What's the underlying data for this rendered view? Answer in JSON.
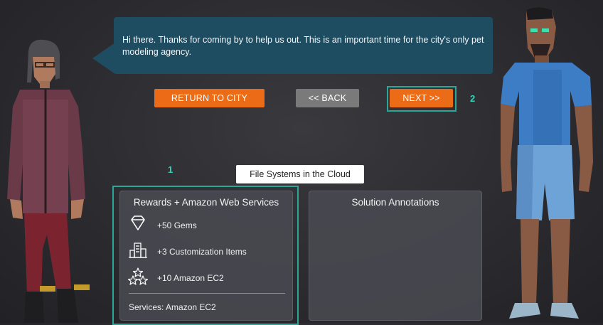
{
  "dialog": {
    "message": "Hi there. Thanks for coming by to help us out. This is an important time for the city's only pet modeling agency."
  },
  "buttons": {
    "return_label": "RETURN TO CITY",
    "back_label": "<< BACK",
    "next_label": "NEXT >>"
  },
  "markers": {
    "one": "1",
    "two": "2"
  },
  "tooltip": "File Systems in the Cloud",
  "rewards_panel": {
    "title": "Rewards + Amazon Web Services",
    "items": [
      {
        "icon": "gem-icon",
        "label": "+50 Gems"
      },
      {
        "icon": "building-icon",
        "label": "+3 Customization Items"
      },
      {
        "icon": "stars-icon",
        "label": "+10 Amazon EC2"
      }
    ],
    "services": "Services: Amazon EC2"
  },
  "annotations_panel": {
    "title": "Solution Annotations"
  },
  "colors": {
    "accent_orange": "#ec6b16",
    "button_gray": "#7a7a7a",
    "highlight_teal": "#2aa796",
    "dialog_blue": "#1e4c61"
  }
}
